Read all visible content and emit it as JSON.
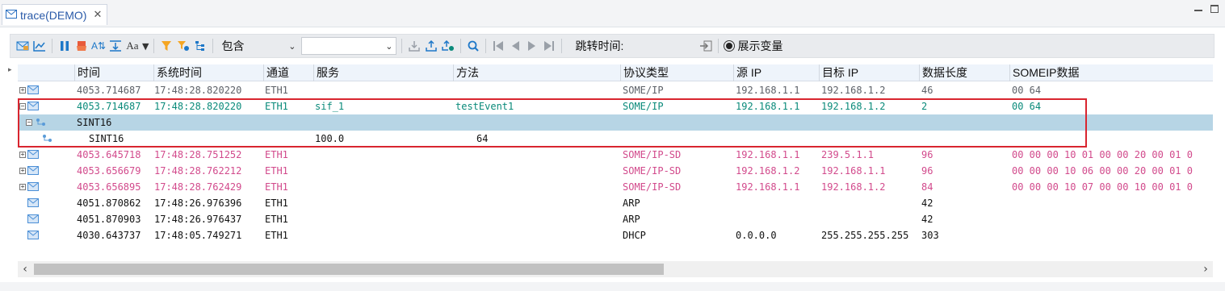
{
  "tab": {
    "title": "trace(DEMO)",
    "close_glyph": "✕",
    "icon": "envelope-icon"
  },
  "toolbar": {
    "filter_combo": "包含",
    "filter_value": "",
    "jump_label": "跳转时间:",
    "show_var_label": "展示变量"
  },
  "columns": [
    "时间",
    "系统时间",
    "通道",
    "服务",
    "方法",
    "协议类型",
    "源 IP",
    "目标 IP",
    "数据长度",
    "SOMEIP数据"
  ],
  "rows": [
    {
      "type": "msg",
      "expander": "+",
      "color": "gray",
      "time": "4053.714687",
      "systime": "17:48:28.820220",
      "channel": "ETH1",
      "service": "",
      "method": "",
      "protocol": "SOME/IP",
      "src": "192.168.1.1",
      "dst": "192.168.1.2",
      "len": "46",
      "data": "00 64"
    },
    {
      "type": "msg",
      "expander": "−",
      "color": "teal",
      "time": "4053.714687",
      "systime": "17:48:28.820220",
      "channel": "ETH1",
      "service": "sif_1",
      "method": "testEvent1",
      "protocol": "SOME/IP",
      "src": "192.168.1.1",
      "dst": "192.168.1.2",
      "len": "2",
      "data": "00 64"
    },
    {
      "type": "group",
      "expander": "−",
      "label": "SINT16"
    },
    {
      "type": "signal",
      "label": "SINT16",
      "value": "100.0",
      "raw": "64"
    },
    {
      "type": "msg",
      "expander": "+",
      "color": "pink",
      "time": "4053.645718",
      "systime": "17:48:28.751252",
      "channel": "ETH1",
      "service": "",
      "method": "",
      "protocol": "SOME/IP-SD",
      "src": "192.168.1.1",
      "dst": "239.5.1.1",
      "len": "96",
      "data": "00 00 00 10 01 00 00 20 00 01 0"
    },
    {
      "type": "msg",
      "expander": "+",
      "color": "pink",
      "time": "4053.656679",
      "systime": "17:48:28.762212",
      "channel": "ETH1",
      "service": "",
      "method": "",
      "protocol": "SOME/IP-SD",
      "src": "192.168.1.2",
      "dst": "192.168.1.1",
      "len": "96",
      "data": "00 00 00 10 06 00 00 20 00 01 0"
    },
    {
      "type": "msg",
      "expander": "+",
      "color": "pink",
      "time": "4053.656895",
      "systime": "17:48:28.762429",
      "channel": "ETH1",
      "service": "",
      "method": "",
      "protocol": "SOME/IP-SD",
      "src": "192.168.1.1",
      "dst": "192.168.1.2",
      "len": "84",
      "data": "00 00 00 10 07 00 00 10 00 01 0"
    },
    {
      "type": "msg",
      "expander": "",
      "color": "black",
      "time": "4051.870862",
      "systime": "17:48:26.976396",
      "channel": "ETH1",
      "service": "",
      "method": "",
      "protocol": "ARP",
      "src": "",
      "dst": "",
      "len": "42",
      "data": ""
    },
    {
      "type": "msg",
      "expander": "",
      "color": "black",
      "time": "4051.870903",
      "systime": "17:48:26.976437",
      "channel": "ETH1",
      "service": "",
      "method": "",
      "protocol": "ARP",
      "src": "",
      "dst": "",
      "len": "42",
      "data": ""
    },
    {
      "type": "msg",
      "expander": "",
      "color": "black",
      "time": "4030.643737",
      "systime": "17:48:05.749271",
      "channel": "ETH1",
      "service": "",
      "method": "",
      "protocol": "DHCP",
      "src": "0.0.0.0",
      "dst": "255.255.255.255",
      "len": "303",
      "data": ""
    }
  ]
}
